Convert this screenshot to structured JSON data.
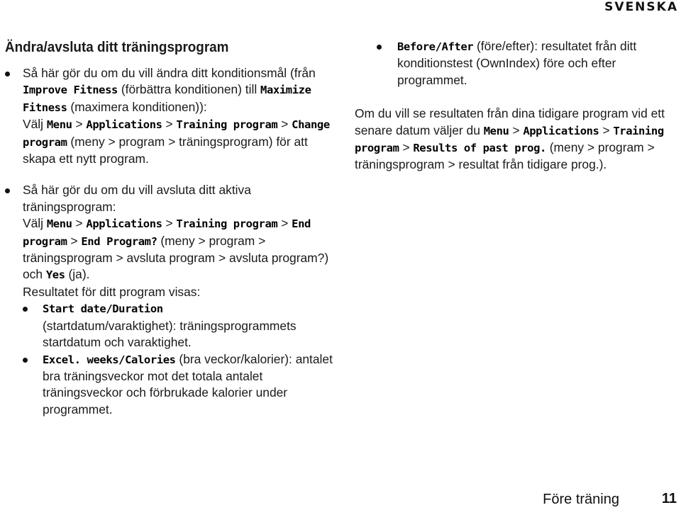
{
  "header": {
    "language": "SVENSKA"
  },
  "left": {
    "title": "Ändra/avsluta ditt träningsprogram",
    "bullet1": {
      "t1": "Så här gör du om du vill ändra ditt konditionsmål (från ",
      "ui1": "Improve Fitness",
      "t2": " (förbättra konditionen) till ",
      "ui2": "Maximize Fitness",
      "t3": " (maximera konditionen)):",
      "t4": "Välj ",
      "ui3": "Menu",
      "sep1": " > ",
      "ui4": "Applications",
      "sep2": " > ",
      "ui5": "Training program",
      "sep3": " > ",
      "ui6": "Change program",
      "t5": " (meny > program > träningsprogram) för att skapa ett nytt program."
    },
    "bullet2": {
      "t1": "Så här gör du om du vill avsluta ditt aktiva träningsprogram:",
      "t2": "Välj ",
      "ui1": "Menu",
      "sep1": " > ",
      "ui2": "Applications",
      "sep2": " > ",
      "ui3": "Training program",
      "sep3": " > ",
      "ui4": "End program",
      "sep4": " > ",
      "ui5": "End Program?",
      "t3": " (meny > program > träningsprogram > avsluta program > avsluta program?) och ",
      "ui6": "Yes",
      "t4": " (ja).",
      "t5": "Resultatet för ditt program visas:",
      "sub": [
        {
          "ui": "Start date/Duration",
          "text": " (startdatum/varaktighet): träningsprogrammets startdatum och varaktighet."
        },
        {
          "ui": "Excel. weeks/Calories",
          "text": " (bra veckor/kalorier): antalet bra träningsveckor mot det totala antalet träningsveckor och förbrukade kalorier under programmet."
        }
      ]
    }
  },
  "right": {
    "bullet": {
      "ui": "Before/After",
      "text": " (före/efter): resultatet från ditt konditionstest (OwnIndex) före och efter programmet."
    },
    "para": {
      "t1": "Om du vill se resultaten från dina tidigare program vid ett senare datum väljer du ",
      "ui1": "Menu",
      "sep1": " > ",
      "ui2": "Applications",
      "sep2": " > ",
      "ui3": "Training program",
      "sep3": " > ",
      "ui4": "Results of past prog.",
      "t2": " (meny > program > träningsprogram > resultat från tidigare prog.)."
    }
  },
  "footer": {
    "section": "Före träning",
    "page": "11"
  }
}
